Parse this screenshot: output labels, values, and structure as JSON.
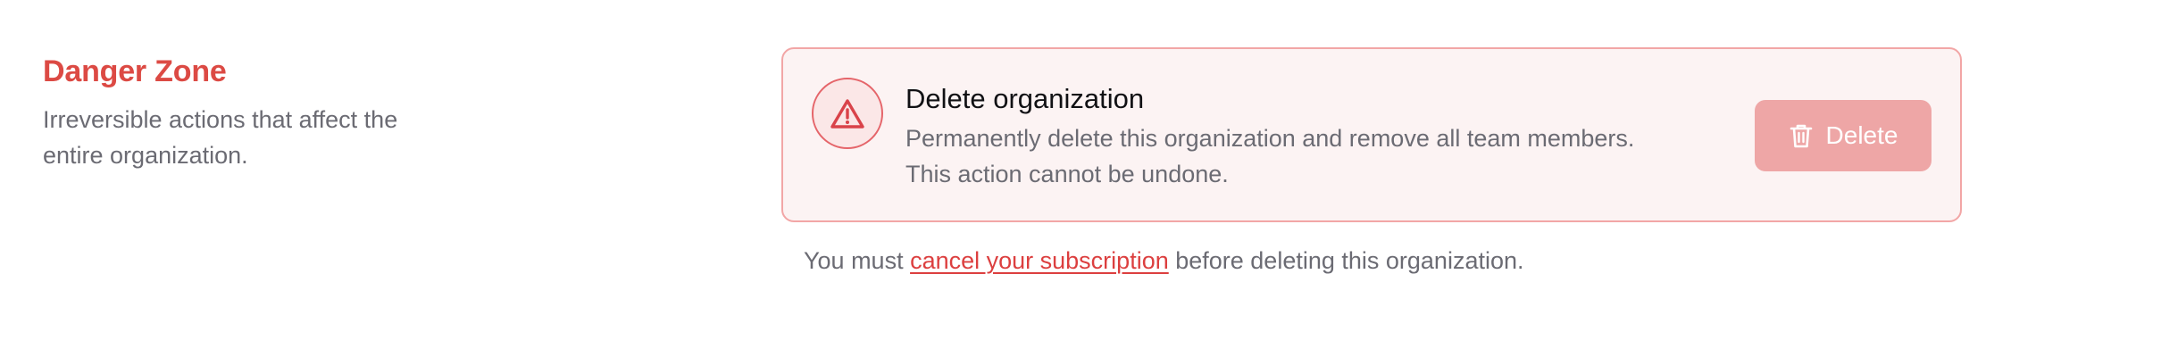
{
  "danger_zone": {
    "title": "Danger Zone",
    "description": "Irreversible actions that affect the entire organization."
  },
  "delete_card": {
    "icon": "warning-triangle-icon",
    "title": "Delete organization",
    "description_line1": "Permanently delete this organization and remove all team members.",
    "description_line2": "This action cannot be undone.",
    "button_icon": "trash-icon",
    "button_label": "Delete"
  },
  "note": {
    "prefix": "You must ",
    "link_text": "cancel your subscription",
    "suffix": " before deleting this organization."
  },
  "colors": {
    "danger": "#dc4a44",
    "card_bg": "#fcf3f3",
    "card_border": "#f2a6a6",
    "button_bg": "#eea6a6",
    "muted_text": "#6b6b73"
  }
}
